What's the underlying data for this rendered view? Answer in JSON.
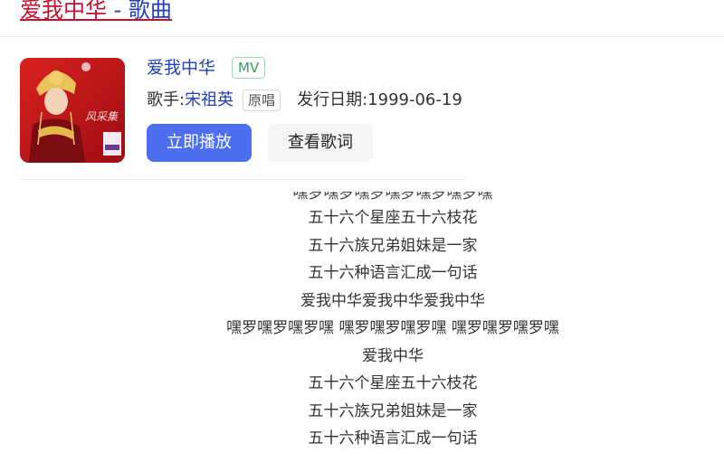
{
  "header": {
    "title": "爱我中华",
    "suffix": " - 歌曲"
  },
  "song": {
    "name": "爱我中华",
    "mv_badge": "MV",
    "singer_label": "歌手:",
    "singer": "宋祖英",
    "original_badge": "原唱",
    "release_label": "发行日期:",
    "release_date": "1999-06-19",
    "cover_text": "风采集"
  },
  "actions": {
    "play": "立即播放",
    "lyrics": "查看歌词"
  },
  "lyrics": [
    "嘿罗嘿罗嘿罗嘿罗嘿罗嘿罗嘿",
    "五十六个星座五十六枝花",
    "五十六族兄弟姐妹是一家",
    "五十六种语言汇成一句话",
    "爱我中华爱我中华爱我中华",
    "嘿罗嘿罗嘿罗嘿 嘿罗嘿罗嘿罗嘿 嘿罗嘿罗嘿罗嘿",
    "爱我中华",
    "五十六个星座五十六枝花",
    "五十六族兄弟姐妹是一家",
    "五十六种语言汇成一句话"
  ],
  "colors": {
    "title_red": "#c8102e",
    "link_blue": "#2440b3",
    "play_button": "#4e6ef2",
    "mv_green": "#2ea562"
  }
}
